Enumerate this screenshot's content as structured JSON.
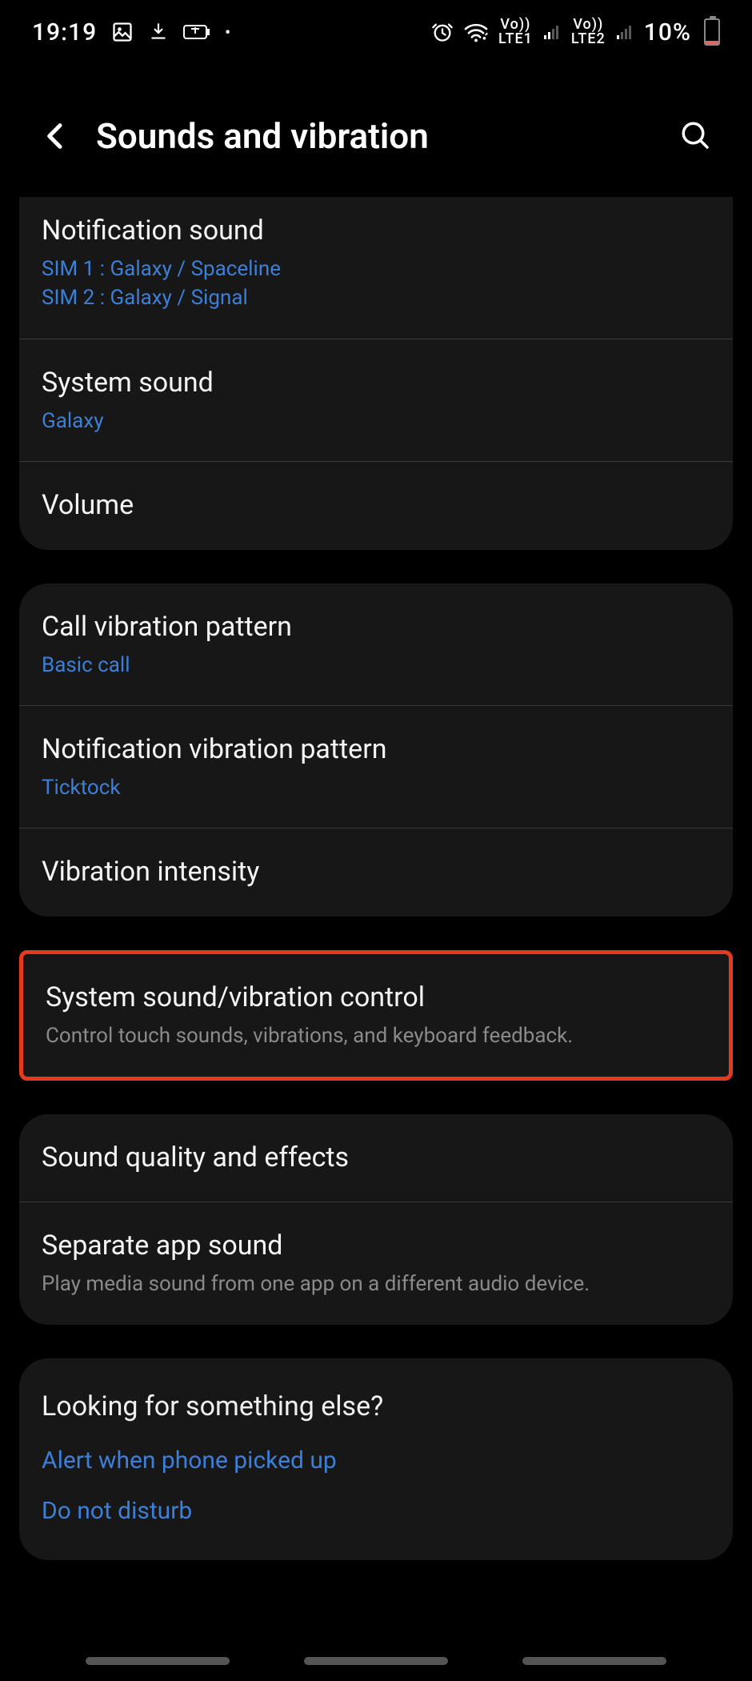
{
  "status": {
    "time": "19:19",
    "battery_pct": "10%"
  },
  "header": {
    "title": "Sounds and vibration"
  },
  "group1": {
    "notif_sound": {
      "title": "Notification sound",
      "sub1": "SIM 1 : Galaxy / Spaceline",
      "sub2": "SIM 2 : Galaxy / Signal"
    },
    "system_sound": {
      "title": "System sound",
      "sub": "Galaxy"
    },
    "volume": {
      "title": "Volume"
    }
  },
  "group2": {
    "call_vib": {
      "title": "Call vibration pattern",
      "sub": "Basic call"
    },
    "notif_vib": {
      "title": "Notification vibration pattern",
      "sub": "Ticktock"
    },
    "vib_intensity": {
      "title": "Vibration intensity"
    }
  },
  "group3": {
    "sys_control": {
      "title": "System sound/vibration control",
      "desc": "Control touch sounds, vibrations, and keyboard feedback."
    }
  },
  "group4": {
    "sound_quality": {
      "title": "Sound quality and effects"
    },
    "separate_app": {
      "title": "Separate app sound",
      "desc": "Play media sound from one app on a different audio device."
    }
  },
  "footer": {
    "title": "Looking for something else?",
    "link1": "Alert when phone picked up",
    "link2": "Do not disturb"
  }
}
